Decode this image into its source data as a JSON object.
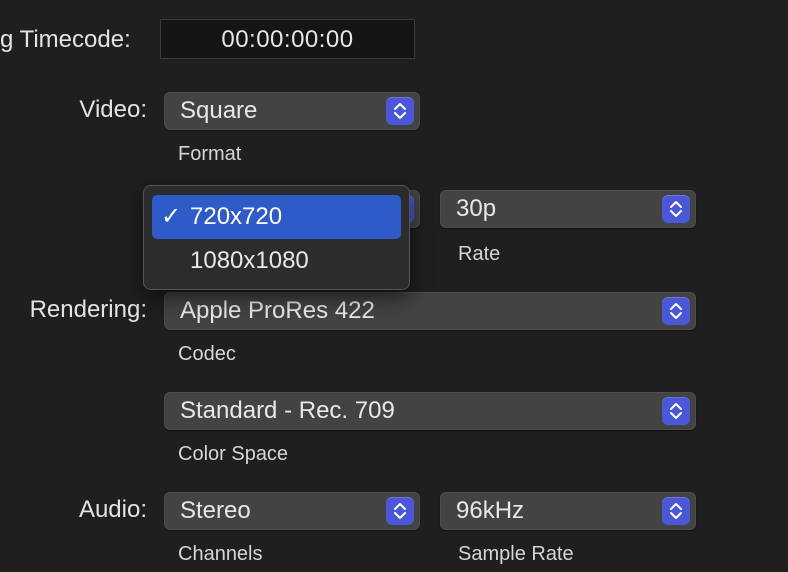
{
  "timecode": {
    "label": "g Timecode:",
    "value": "00:00:00:00"
  },
  "video": {
    "label": "Video:",
    "format_value": "Square",
    "format_caption": "Format",
    "rate_value": "30p",
    "rate_caption": "Rate",
    "resolution_menu": {
      "options": [
        {
          "label": "720x720",
          "selected": true,
          "check": "✓"
        },
        {
          "label": "1080x1080",
          "selected": false,
          "check": ""
        }
      ]
    }
  },
  "rendering": {
    "label": "Rendering:",
    "codec_value": "Apple ProRes 422",
    "codec_caption": "Codec",
    "colorspace_value": "Standard - Rec. 709",
    "colorspace_caption": "Color Space"
  },
  "audio": {
    "label": "Audio:",
    "channels_value": "Stereo",
    "channels_caption": "Channels",
    "samplerate_value": "96kHz",
    "samplerate_caption": "Sample Rate"
  },
  "icons": {
    "stepper": "chevron-up-down-icon",
    "check": "checkmark-icon"
  },
  "colors": {
    "background": "#1f1f1f",
    "popup": "#434343",
    "stepper_accent": "#4a58d8",
    "menu_selection": "#2f5bc8"
  }
}
